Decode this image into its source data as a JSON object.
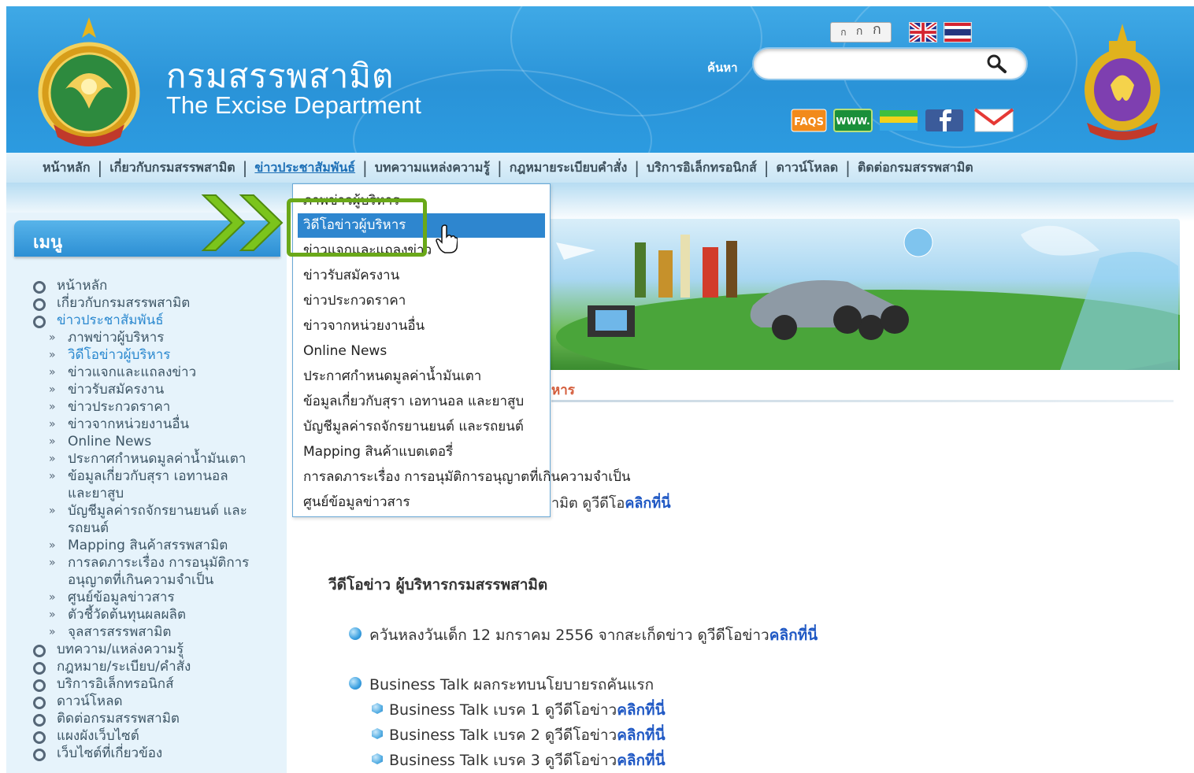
{
  "header": {
    "title_th": "กรมสรรพสามิต",
    "title_en": "The Excise Department",
    "font_size_controls": [
      "ก",
      "ก",
      "ก"
    ],
    "search_label": "ค้นหา",
    "search_value": "",
    "quick_links": [
      "faqs-icon",
      "www-icon",
      "folder-icon",
      "facebook-icon",
      "mail-icon"
    ],
    "quick_link_faqs_text": "FAQS",
    "quick_link_www_text": "WWW."
  },
  "nav": {
    "items": [
      "หน้าหลัก",
      "เกี่ยวกับกรมสรรพสามิต",
      "ข่าวประชาสัมพันธ์",
      "บทความแหล่งความรู้",
      "กฎหมายระเบียบคำสั่ง",
      "บริการอิเล็กทรอนิกส์",
      "ดาวน์โหลด",
      "ติดต่อกรมสรรพสามิต"
    ],
    "active_index": 2
  },
  "sidebar": {
    "title": "เมนู",
    "items": [
      "หน้าหลัก",
      "เกี่ยวกับกรมสรรพสามิต",
      "ข่าวประชาสัมพันธ์",
      "ภาพข่าวผู้บริหาร",
      "วิดีโอข่าวผู้บริหาร",
      "ข่าวแจกและแถลงข่าว",
      "ข่าวรับสมัครงาน",
      "ข่าวประกวดราคา",
      "ข่าวจากหน่วยงานอื่น",
      "Online News",
      "ประกาศกำหนดมูลค่าน้ำมันเตา",
      "ข้อมูลเกี่ยวกับสุรา เอทานอล",
      "และยาสูบ",
      "บัญชีมูลค่ารถจักรยานยนต์ และ",
      "รถยนต์",
      "Mapping สินค้าสรรพสามิต",
      "การลดภาระเรื่อง การอนุมัติการ",
      "อนุญาตที่เกินความจำเป็น",
      "ศูนย์ข้อมูลข่าวสาร",
      "ตัวชี้วัดต้นทุนผลผลิต",
      "จุลสารสรรพสามิต",
      "บทความ/แหล่งความรู้",
      "กฎหมาย/ระเบียบ/คำสั่ง",
      "บริการอิเล็กทรอนิกส์",
      "ดาวน์โหลด",
      "ติดต่อกรมสรรพสามิต",
      "แผงผังเว็บไซต์",
      "เว็บไซต์ที่เกี่ยวข้อง"
    ]
  },
  "dropdown": {
    "items": [
      "ภาพข่าวผู้บริหาร",
      "วิดีโอข่าวผู้บริหาร",
      "ข่าวแจกและแถลงข่าว",
      "ข่าวรับสมัครงาน",
      "ข่าวประกวดราคา",
      "ข่าวจากหน่วยงานอื่น",
      "Online News",
      "ประกาศกำหนดมูลค่าน้ำมันเตา",
      "ข้อมูลเกี่ยวกับสุรา เอทานอล และยาสูบ",
      "บัญชีมูลค่ารถจักรยานยนต์ และรถยนต์",
      "Mapping สินค้าแบตเตอรี่",
      "การลดภาระเรื่อง การอนุมัติการอนุญาตที่เกินความจำเป็น",
      "ศูนย์ข้อมูลข่าวสาร"
    ],
    "highlighted_index": 1
  },
  "main": {
    "heading_tail": "หาร",
    "link_tail_text": "ามิต ดูวีดีโอ",
    "link_tail_link": "คลิกที่นี่",
    "content_title": "วีดีโอข่าว ผู้บริหารกรมสรรพสามิต",
    "items": [
      {
        "text": "ควันหลงวันเด็ก 12 มกราคม 2556 จากสะเก็ดข่าว ดูวีดีโอข่าว",
        "link": "คลิกที่นี่"
      },
      {
        "text": "Business Talk ผลกระทบนโยบายรถคันแรก",
        "link": ""
      }
    ],
    "sub_items": [
      {
        "text": "Business Talk เบรค 1 ดูวีดีโอข่าว",
        "link": "คลิกที่นี่"
      },
      {
        "text": "Business Talk เบรค 2 ดูวีดีโอข่าว",
        "link": "คลิกที่นี่"
      },
      {
        "text": "Business Talk เบรค 3 ดูวีดีโอข่าว",
        "link": "คลิกที่นี่"
      }
    ]
  },
  "colors": {
    "header_blue": "#2a93d8",
    "nav_active": "#1c6fb6",
    "dropdown_highlight": "#2e86cf",
    "link_blue": "#1f58c4",
    "annotation_green": "#6aa819",
    "sidebar_active": "#2a88cf"
  }
}
